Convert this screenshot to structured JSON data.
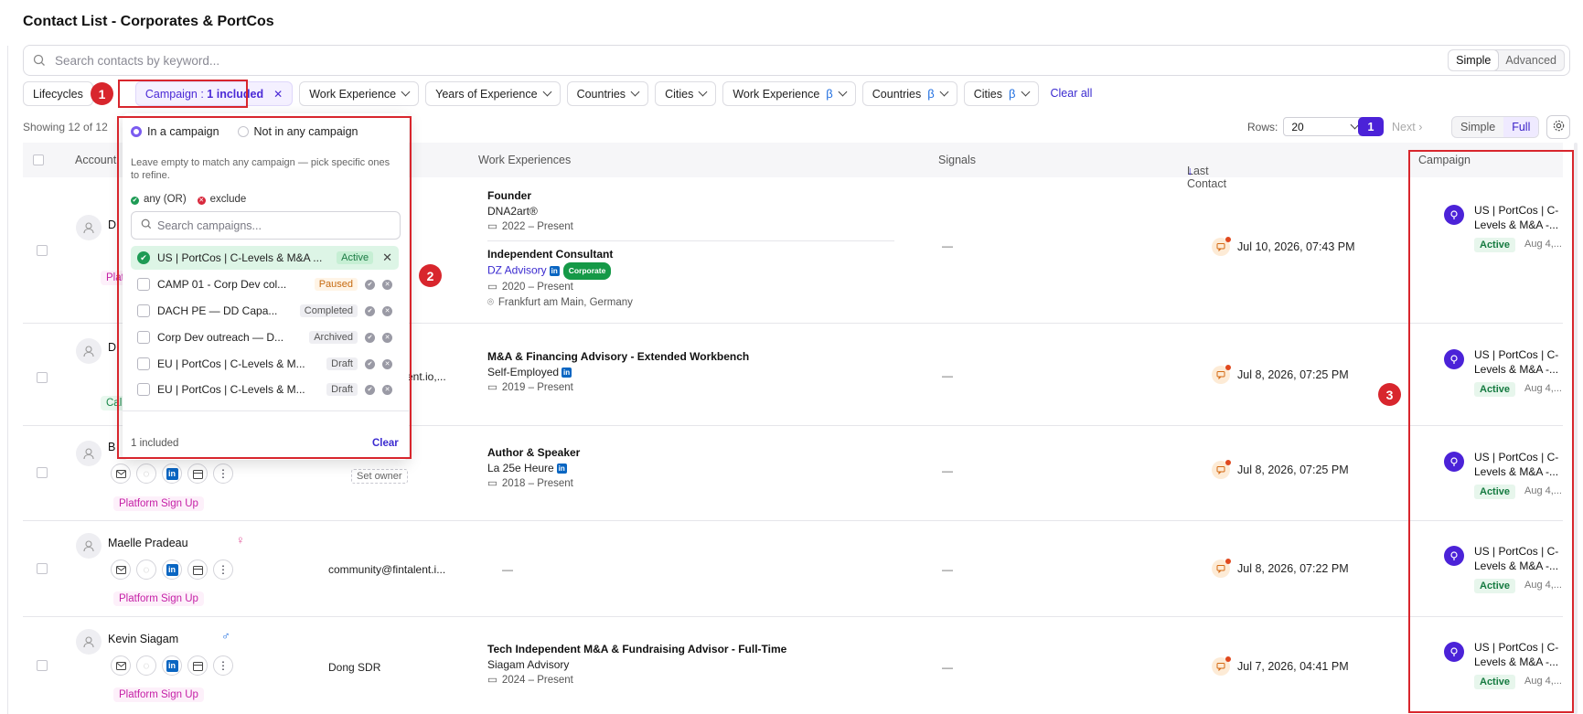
{
  "page": {
    "title": "Contact List - Corporates & PortCos"
  },
  "search": {
    "placeholder": "Search contacts by keyword...",
    "mode_simple": "Simple",
    "mode_advanced": "Advanced"
  },
  "filters": {
    "lifecycles": "Lifecycles",
    "campaign_prefix": "Campaign : ",
    "campaign_value": "1 included",
    "work_experience": "Work Experience",
    "years_of_experience": "Years of Experience",
    "countries": "Countries",
    "cities": "Cities",
    "work_experience_beta": "Work Experience",
    "countries_beta": "Countries",
    "cities_beta": "Cities",
    "beta": "β",
    "clear_all": "Clear all"
  },
  "toolbar": {
    "showing": "Showing 12 of 12",
    "rows_label": "Rows:",
    "rows_value": "20",
    "page": "1",
    "next": "Next",
    "view_simple": "Simple",
    "view_full": "Full"
  },
  "columns": {
    "account": "Account",
    "work_experiences": "Work Experiences",
    "signals": "Signals",
    "last_contact": "Last Contact",
    "campaign": "Campaign"
  },
  "rows": [
    {
      "name_initial": "D",
      "tag": "Platf",
      "experiences": [
        {
          "title": "Founder",
          "company": "DNA2art®",
          "dates": "2022 – Present"
        },
        {
          "title": "Independent Consultant",
          "company": "DZ Advisory",
          "badge": "Corporate",
          "dates": "2020 – Present",
          "location": "Frankfurt am Main, Germany"
        }
      ],
      "signals": "—",
      "last_contact": "Jul 10, 2026, 07:43 PM",
      "campaign": {
        "name": "US | PortCos | C-Levels & M&A -...",
        "status": "Active",
        "date": "Aug 4,..."
      }
    },
    {
      "name_initial": "D",
      "tag": "Call",
      "account": "ent.io,...",
      "experiences": [
        {
          "title": "M&A & Financing Advisory - Extended Workbench",
          "company": "Self-Employed",
          "dates": "2019 – Present"
        }
      ],
      "signals": "—",
      "last_contact": "Jul 8, 2026, 07:25 PM",
      "campaign": {
        "name": "US | PortCos | C-Levels & M&A -...",
        "status": "Active",
        "date": "Aug 4,..."
      }
    },
    {
      "name_initial": "B",
      "tag": "Platform Sign Up",
      "owner": "Set owner",
      "experiences": [
        {
          "title": "Author & Speaker",
          "company": "La 25e Heure",
          "dates": "2018 – Present"
        }
      ],
      "signals": "—",
      "last_contact": "Jul 8, 2026, 07:25 PM",
      "campaign": {
        "name": "US | PortCos | C-Levels & M&A -...",
        "status": "Active",
        "date": "Aug 4,..."
      }
    },
    {
      "name": "Maelle Pradeau",
      "gender": "♀",
      "tag": "Platform Sign Up",
      "account": "community@fintalent.i...",
      "work_dash": "—",
      "signals": "—",
      "last_contact": "Jul 8, 2026, 07:22 PM",
      "campaign": {
        "name": "US | PortCos | C-Levels & M&A -...",
        "status": "Active",
        "date": "Aug 4,..."
      }
    },
    {
      "name": "Kevin Siagam",
      "gender": "♂",
      "tag": "Platform Sign Up",
      "account": "Dong SDR",
      "experiences": [
        {
          "title": "Tech Independent M&A & Fundraising Advisor - Full-Time",
          "company": "Siagam Advisory",
          "dates": "2024 – Present"
        }
      ],
      "signals": "—",
      "last_contact": "Jul 7, 2026, 04:41 PM",
      "campaign": {
        "name": "US | PortCos | C-Levels & M&A -...",
        "status": "Active",
        "date": "Aug 4,..."
      }
    }
  ],
  "campaign_panel": {
    "radio_in": "In a campaign",
    "radio_not": "Not in any campaign",
    "hint": "Leave empty to match any campaign — pick specific ones to refine.",
    "legend_any": "any (OR)",
    "legend_exclude": "exclude",
    "search_placeholder": "Search campaigns...",
    "items": [
      {
        "name": "US | PortCos | C-Levels & M&A ...",
        "status": "Active",
        "selected": true
      },
      {
        "name": "CAMP 01 - Corp Dev col...",
        "status": "Paused"
      },
      {
        "name": "DACH PE — DD Capa...",
        "status": "Completed"
      },
      {
        "name": "Corp Dev outreach — D...",
        "status": "Archived"
      },
      {
        "name": "EU | PortCos | C-Levels & M...",
        "status": "Draft"
      },
      {
        "name": "EU | PortCos | C-Levels & M...",
        "status": "Draft"
      }
    ],
    "footer_count": "1 included",
    "footer_clear": "Clear"
  },
  "annotations": {
    "m1": "1",
    "m2": "2",
    "m3": "3"
  },
  "colors": {
    "accent": "#4b22d8",
    "annotation": "#d8262d",
    "active": "#1e9b55"
  }
}
